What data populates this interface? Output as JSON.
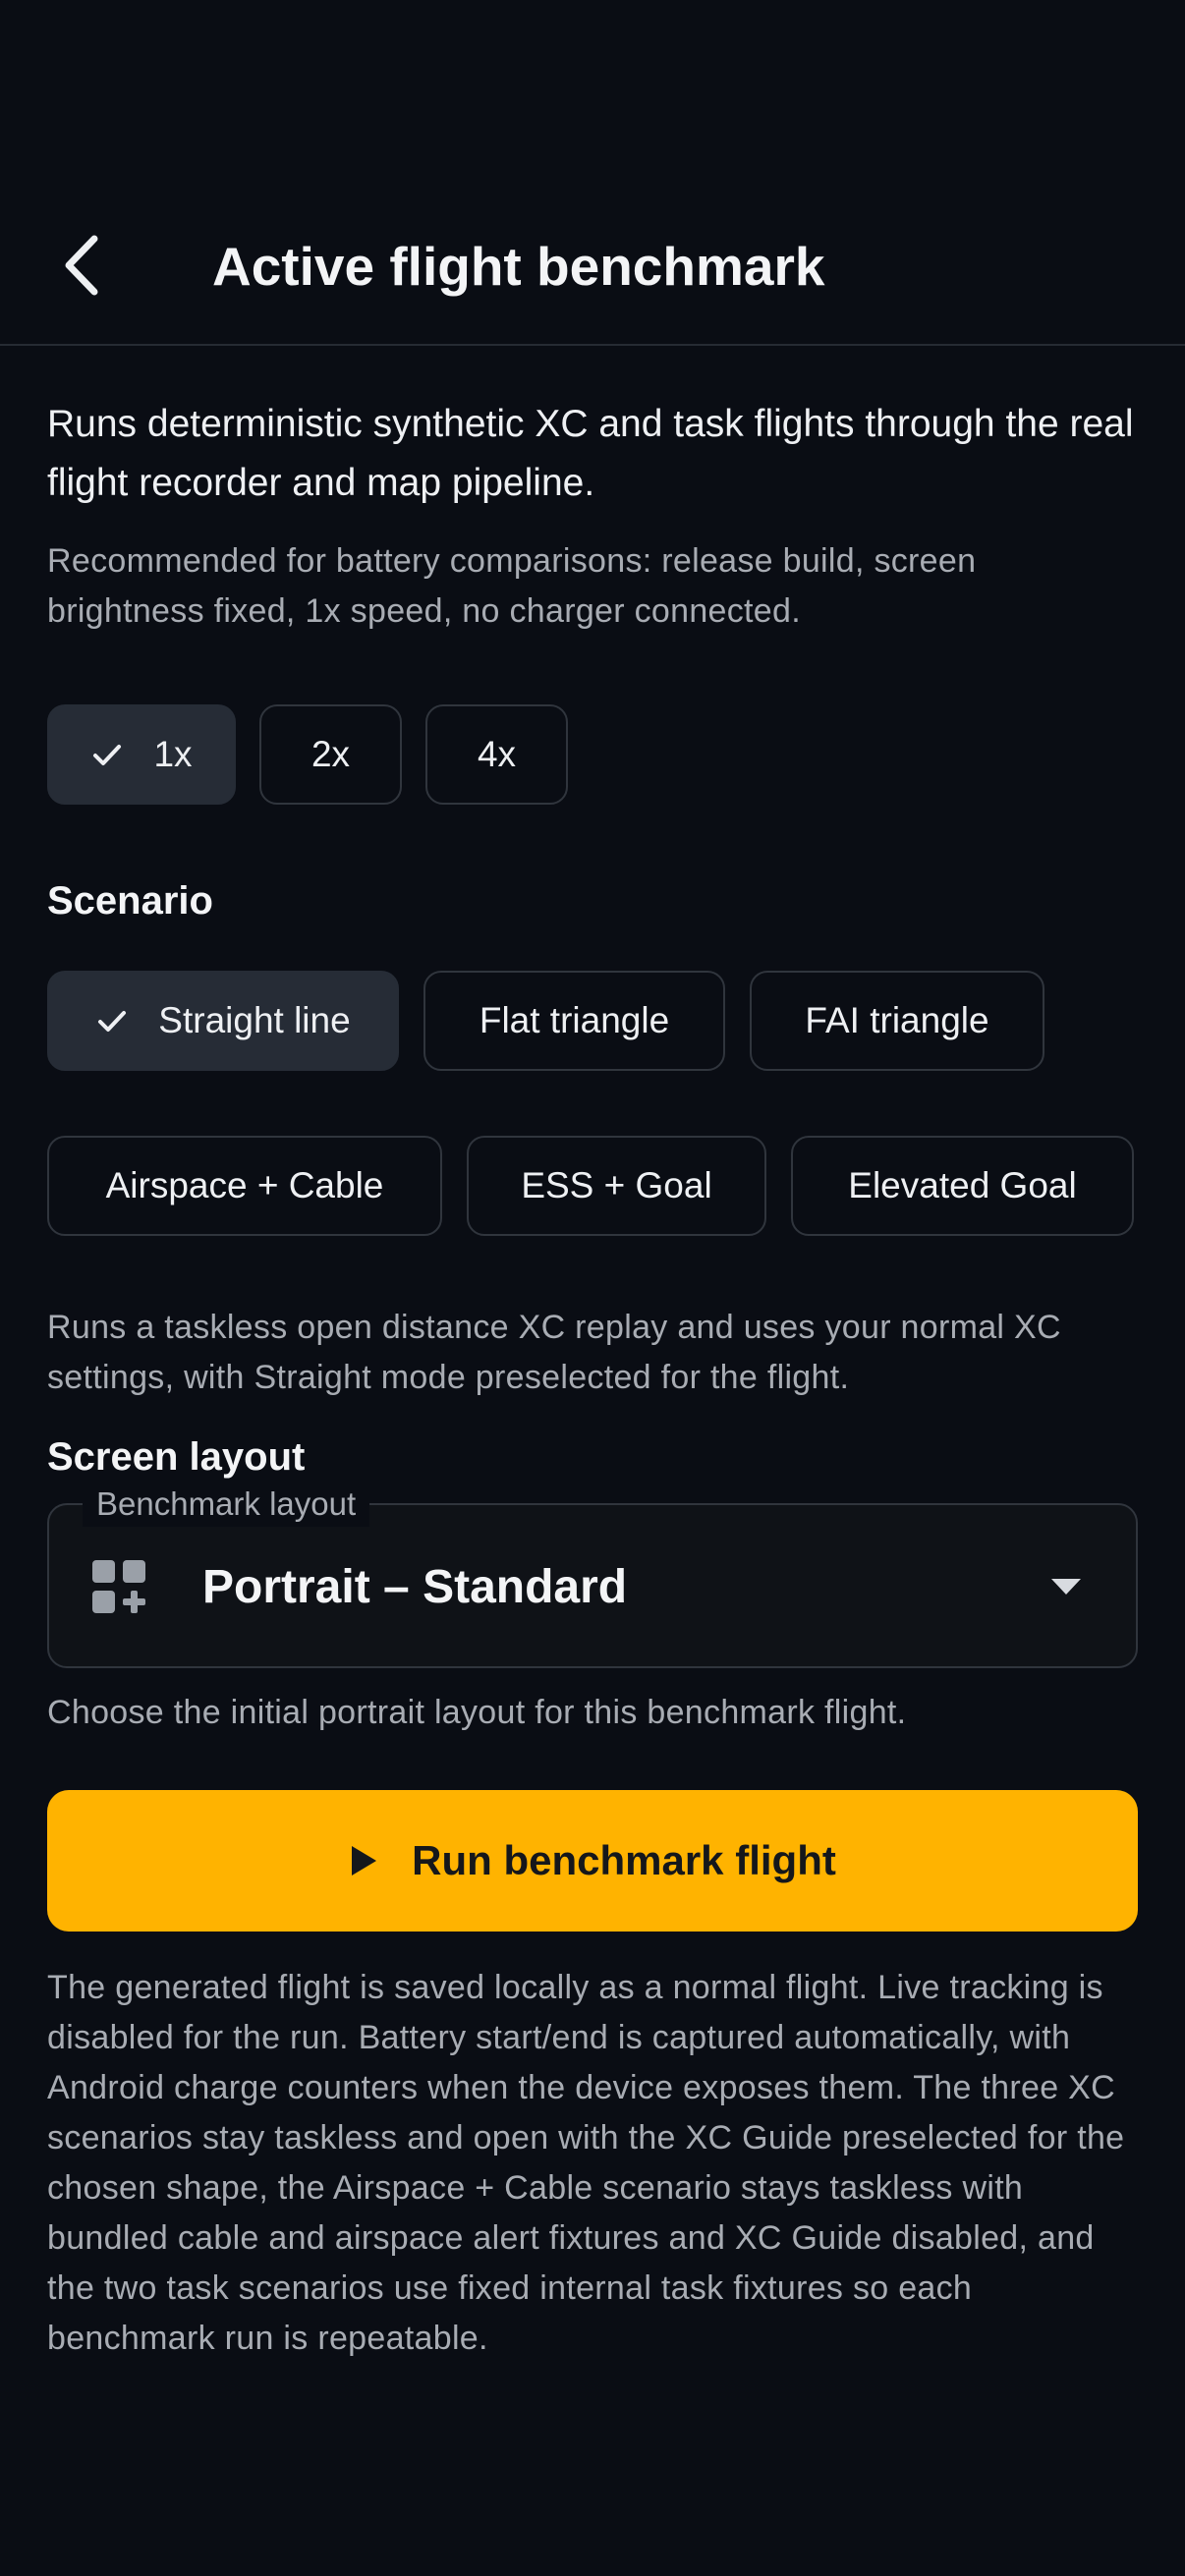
{
  "header": {
    "title": "Active flight benchmark"
  },
  "intro": {
    "text": "Runs deterministic synthetic XC and task flights through the real flight recorder and map pipeline.",
    "note": "Recommended for battery comparisons: release build, screen brightness fixed, 1x speed, no charger connected."
  },
  "speed": {
    "options": [
      "1x",
      "2x",
      "4x"
    ],
    "selected": "1x"
  },
  "scenario": {
    "label": "Scenario",
    "options": [
      "Straight line",
      "Flat triangle",
      "FAI triangle",
      "Airspace + Cable",
      "ESS + Goal",
      "Elevated Goal"
    ],
    "selected": "Straight line",
    "description": "Runs a taskless open distance XC replay and uses your normal XC settings, with Straight mode preselected for the flight."
  },
  "layout": {
    "label": "Screen layout",
    "field_label": "Benchmark layout",
    "value": "Portrait – Standard",
    "helper": "Choose the initial portrait layout for this benchmark flight."
  },
  "run_button": {
    "label": "Run benchmark flight"
  },
  "footer": {
    "text": "The generated flight is saved locally as a normal flight. Live tracking is disabled for the run. Battery start/end is captured automatically, with Android charge counters when the device exposes them. The three XC scenarios stay taskless and open with the XC Guide preselected for the chosen shape, the Airspace + Cable scenario stays taskless with bundled cable and airspace alert fixtures and XC Guide disabled, and the two task scenarios use fixed internal task fixtures so each benchmark run is repeatable."
  },
  "colors": {
    "background": "#0a0d14",
    "accent": "#ffb300",
    "chip_selected": "#262c36"
  },
  "icons": {
    "back": "chevron-left-icon",
    "check": "check-icon",
    "layout": "dashboard-add-icon",
    "dropdown": "caret-down-icon",
    "run": "play-icon"
  }
}
